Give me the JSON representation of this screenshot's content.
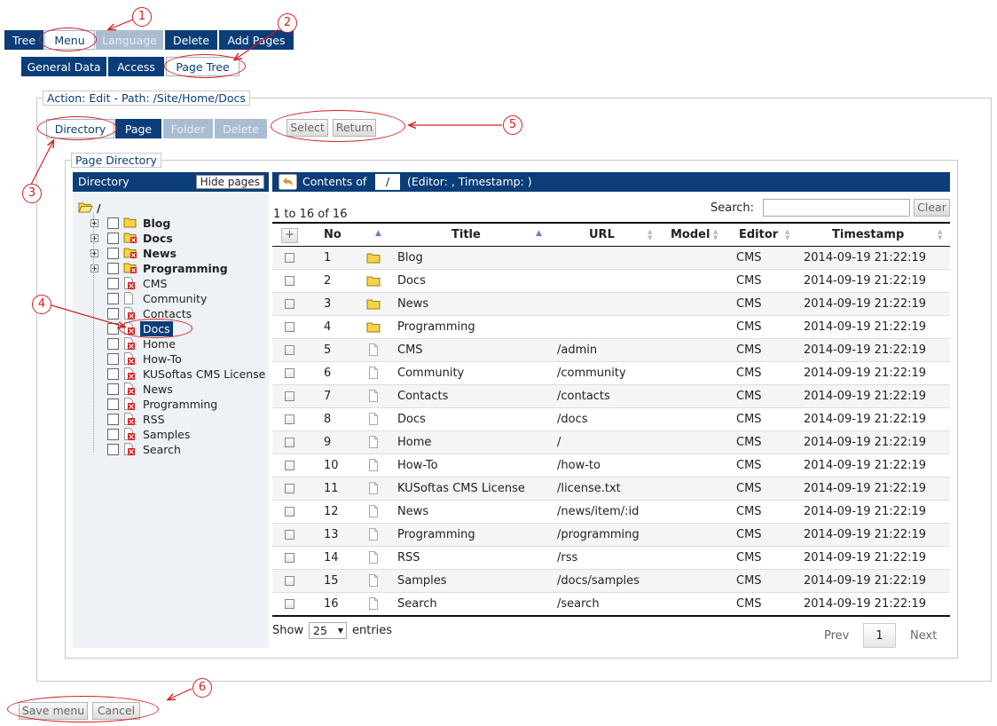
{
  "top_tabs": [
    {
      "label": "Tree",
      "state": "normal"
    },
    {
      "label": "Menu",
      "state": "active"
    },
    {
      "label": "Language",
      "state": "disabled"
    },
    {
      "label": "Delete",
      "state": "normal"
    },
    {
      "label": "Add Pages",
      "state": "normal"
    }
  ],
  "sub_tabs": [
    {
      "label": "General Data",
      "state": "normal"
    },
    {
      "label": "Access",
      "state": "normal"
    },
    {
      "label": "Page Tree",
      "state": "active"
    }
  ],
  "action_legend": "Action: Edit - Path: /Site/Home/Docs",
  "mode_tabs": [
    {
      "label": "Directory",
      "state": "active"
    },
    {
      "label": "Page",
      "state": "normal"
    },
    {
      "label": "Folder",
      "state": "disabled"
    },
    {
      "label": "Delete",
      "state": "disabled"
    }
  ],
  "select_button": "Select",
  "return_button": "Return",
  "page_directory_legend": "Page Directory",
  "tree": {
    "title": "Directory",
    "hide_button": "Hide pages",
    "root": "/",
    "items": [
      {
        "label": "Blog",
        "type": "folder",
        "bold": true,
        "expandable": true
      },
      {
        "label": "Docs",
        "type": "folder-red",
        "bold": true,
        "expandable": true
      },
      {
        "label": "News",
        "type": "folder-red",
        "bold": true,
        "expandable": true
      },
      {
        "label": "Programming",
        "type": "folder-red",
        "bold": true,
        "expandable": true
      },
      {
        "label": "CMS",
        "type": "page-red",
        "bold": false
      },
      {
        "label": "Community",
        "type": "page",
        "bold": false
      },
      {
        "label": "Contacts",
        "type": "page-red",
        "bold": false
      },
      {
        "label": "Docs",
        "type": "page-red",
        "bold": false,
        "selected": true
      },
      {
        "label": "Home",
        "type": "page-red",
        "bold": false
      },
      {
        "label": "How-To",
        "type": "page-red",
        "bold": false
      },
      {
        "label": "KUSoftas CMS License",
        "type": "page-red",
        "bold": false
      },
      {
        "label": "News",
        "type": "page-red",
        "bold": false
      },
      {
        "label": "Programming",
        "type": "page-red",
        "bold": false
      },
      {
        "label": "RSS",
        "type": "page-red",
        "bold": false
      },
      {
        "label": "Samples",
        "type": "page-red",
        "bold": false
      },
      {
        "label": "Search",
        "type": "page-red",
        "bold": false
      }
    ]
  },
  "contents": {
    "prefix": "Contents of",
    "path": "/",
    "suffix": "(Editor: , Timestamp: )"
  },
  "table": {
    "info": "1 to 16 of 16",
    "search_label": "Search:",
    "search_value": "",
    "clear_button": "Clear",
    "headers": {
      "no": "No",
      "title": "Title",
      "url": "URL",
      "model": "Model",
      "editor": "Editor",
      "timestamp": "Timestamp"
    },
    "rows": [
      {
        "no": "1",
        "type": "folder",
        "title": "Blog",
        "url": "",
        "model": "",
        "editor": "CMS",
        "timestamp": "2014-09-19 21:22:19"
      },
      {
        "no": "2",
        "type": "folder",
        "title": "Docs",
        "url": "",
        "model": "",
        "editor": "CMS",
        "timestamp": "2014-09-19 21:22:19"
      },
      {
        "no": "3",
        "type": "folder",
        "title": "News",
        "url": "",
        "model": "",
        "editor": "CMS",
        "timestamp": "2014-09-19 21:22:19"
      },
      {
        "no": "4",
        "type": "folder",
        "title": "Programming",
        "url": "",
        "model": "",
        "editor": "CMS",
        "timestamp": "2014-09-19 21:22:19"
      },
      {
        "no": "5",
        "type": "page",
        "title": "CMS",
        "url": "/admin",
        "model": "",
        "editor": "CMS",
        "timestamp": "2014-09-19 21:22:19"
      },
      {
        "no": "6",
        "type": "page",
        "title": "Community",
        "url": "/community",
        "model": "",
        "editor": "CMS",
        "timestamp": "2014-09-19 21:22:19"
      },
      {
        "no": "7",
        "type": "page",
        "title": "Contacts",
        "url": "/contacts",
        "model": "",
        "editor": "CMS",
        "timestamp": "2014-09-19 21:22:19"
      },
      {
        "no": "8",
        "type": "page",
        "title": "Docs",
        "url": "/docs",
        "model": "",
        "editor": "CMS",
        "timestamp": "2014-09-19 21:22:19"
      },
      {
        "no": "9",
        "type": "page",
        "title": "Home",
        "url": "/",
        "model": "",
        "editor": "CMS",
        "timestamp": "2014-09-19 21:22:19"
      },
      {
        "no": "10",
        "type": "page",
        "title": "How-To",
        "url": "/how-to",
        "model": "",
        "editor": "CMS",
        "timestamp": "2014-09-19 21:22:19"
      },
      {
        "no": "11",
        "type": "page",
        "title": "KUSoftas CMS License",
        "url": "/license.txt",
        "model": "",
        "editor": "CMS",
        "timestamp": "2014-09-19 21:22:19"
      },
      {
        "no": "12",
        "type": "page",
        "title": "News",
        "url": "/news/item/:id",
        "model": "",
        "editor": "CMS",
        "timestamp": "2014-09-19 21:22:19"
      },
      {
        "no": "13",
        "type": "page",
        "title": "Programming",
        "url": "/programming",
        "model": "",
        "editor": "CMS",
        "timestamp": "2014-09-19 21:22:19"
      },
      {
        "no": "14",
        "type": "page",
        "title": "RSS",
        "url": "/rss",
        "model": "",
        "editor": "CMS",
        "timestamp": "2014-09-19 21:22:19"
      },
      {
        "no": "15",
        "type": "page",
        "title": "Samples",
        "url": "/docs/samples",
        "model": "",
        "editor": "CMS",
        "timestamp": "2014-09-19 21:22:19"
      },
      {
        "no": "16",
        "type": "page",
        "title": "Search",
        "url": "/search",
        "model": "",
        "editor": "CMS",
        "timestamp": "2014-09-19 21:22:19"
      }
    ],
    "show_label": "Show",
    "page_length": "25",
    "entries_label": "entries",
    "prev": "Prev",
    "current_page": "1",
    "next": "Next"
  },
  "save_button": "Save menu",
  "cancel_button": "Cancel",
  "callouts": [
    "1",
    "2",
    "3",
    "4",
    "5",
    "6"
  ],
  "colors": {
    "brand": "#0b3d78",
    "annotation": "#d42020",
    "folder": "#f5d547"
  }
}
